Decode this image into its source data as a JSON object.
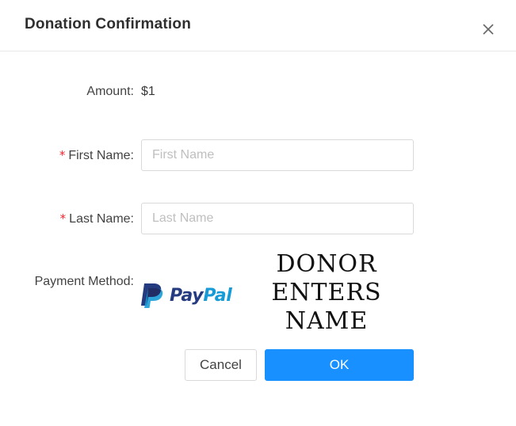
{
  "dialog": {
    "title": "Donation Confirmation",
    "close_icon": "close-icon"
  },
  "form": {
    "amount": {
      "label": "Amount",
      "value": "$1"
    },
    "first_name": {
      "label": "First Name",
      "placeholder": "First Name",
      "value": "",
      "required_mark": "*"
    },
    "last_name": {
      "label": "Last Name",
      "placeholder": "Last Name",
      "value": "",
      "required_mark": "*"
    },
    "payment_method": {
      "label": "Payment Method",
      "logo_text_part1": "Pay",
      "logo_text_part2": "Pal",
      "logo_icon": "paypal-icon"
    },
    "label_separator": ":"
  },
  "overlay_caption": {
    "line1": "DONOR ENTERS",
    "line2": "NAME"
  },
  "buttons": {
    "cancel_label": "Cancel",
    "ok_label": "OK"
  },
  "colors": {
    "primary": "#1890ff",
    "required": "#f5222d",
    "paypal_dark": "#253b80",
    "paypal_light": "#179bd7"
  }
}
